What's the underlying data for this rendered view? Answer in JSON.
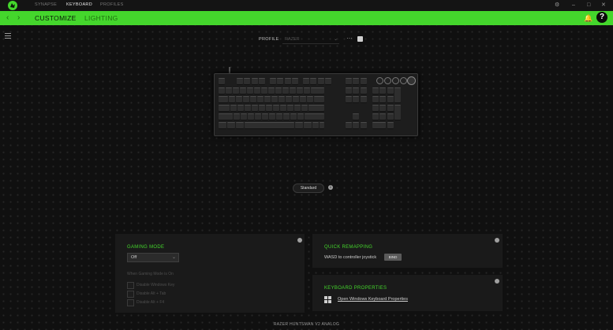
{
  "top_nav": {
    "tabs": [
      {
        "label": "SYNAPSE",
        "active": false
      },
      {
        "label": "KEYBOARD",
        "active": true
      },
      {
        "label": "PROFILES",
        "active": false
      }
    ],
    "window_controls": [
      "settings-icon",
      "minimize-icon",
      "maximize-icon",
      "close-icon"
    ]
  },
  "sub_nav": {
    "tabs": [
      {
        "label": "CUSTOMIZE",
        "active": true
      },
      {
        "label": "LIGHTING",
        "active": false
      }
    ],
    "help_label": "?"
  },
  "profile": {
    "label": "PROFILE",
    "value": "RAZER",
    "more": "···"
  },
  "keyboard_view": {
    "mode_button": "Standard",
    "info": "i"
  },
  "gaming_mode": {
    "title": "GAMING MODE",
    "select_value": "Off",
    "subtitle": "When Gaming Mode is On",
    "options": [
      {
        "label": "Disable Windows Key",
        "checked": false
      },
      {
        "label": "Disable Alt + Tab",
        "checked": false
      },
      {
        "label": "Disable Alt + F4",
        "checked": false
      }
    ]
  },
  "quick_remapping": {
    "title": "QUICK REMAPPING",
    "label": "WASD to controller joystick",
    "button": "BIND"
  },
  "keyboard_properties": {
    "title": "KEYBOARD PROPERTIES",
    "link": "Open Windows Keyboard Properties"
  },
  "device_name": "RAZER HUNTSMAN V2 ANALOG",
  "colors": {
    "accent": "#44d62c",
    "background": "#101010",
    "panel": "#1a1a1a"
  }
}
